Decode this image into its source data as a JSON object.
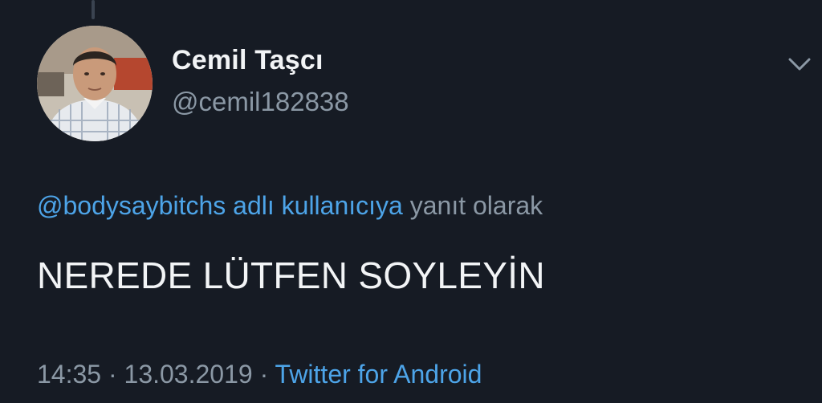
{
  "tweet": {
    "author": {
      "display_name": "Cemil Taşcı",
      "handle": "@cemil182838",
      "avatar_icon": "profile-photo"
    },
    "menu_icon": "chevron-down-icon",
    "reply_to": {
      "mention": "@bodysaybitchs adlı kullanıcıya",
      "suffix": "yanıt olarak"
    },
    "text": "NEREDE LÜTFEN SOYLEYİN",
    "time": "14:35",
    "separator": "·",
    "date": "13.03.2019",
    "source": "Twitter for Android"
  },
  "colors": {
    "background": "#161b24",
    "primary_text": "#f2f4f6",
    "secondary_text": "#8b98a5",
    "link": "#4da4e8"
  }
}
